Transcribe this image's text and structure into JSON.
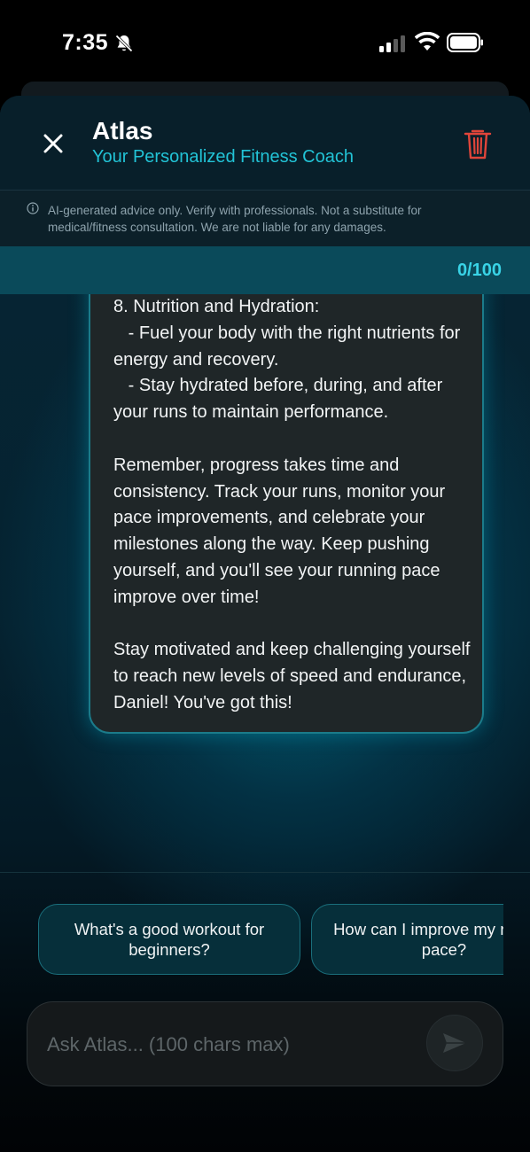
{
  "status_bar": {
    "time": "7:35",
    "icons": [
      "bell-slash-icon",
      "signal-icon",
      "wifi-icon",
      "battery-icon"
    ]
  },
  "header": {
    "title": "Atlas",
    "subtitle": "Your Personalized Fitness Coach",
    "close_icon": "close-icon",
    "delete_icon": "trash-icon"
  },
  "disclaimer": {
    "icon": "info-icon",
    "text": "AI-generated advice only. Verify with professionals. Not a substitute for medical/fitness consultation. We are not liable for any damages."
  },
  "counter": "0/100",
  "message": {
    "text": "8. Nutrition and Hydration:\n   - Fuel your body with the right nutrients for energy and recovery.\n   - Stay hydrated before, during, and after your runs to maintain performance.\n\nRemember, progress takes time and consistency. Track your runs, monitor your pace improvements, and celebrate your milestones along the way. Keep pushing yourself, and you'll see your running pace improve over time!\n\nStay motivated and keep challenging yourself to reach new levels of speed and endurance, Daniel! You've got this!"
  },
  "suggestions": [
    "What's a good workout for beginners?",
    "How can I improve my running pace?"
  ],
  "input": {
    "placeholder": "Ask Atlas... (100 chars max)",
    "value": "",
    "send_icon": "send-icon"
  },
  "colors": {
    "accent": "#22c3d6",
    "counter": "#39d3e6",
    "delete": "#e0453a",
    "bubble_border": "#1b7b8a"
  }
}
